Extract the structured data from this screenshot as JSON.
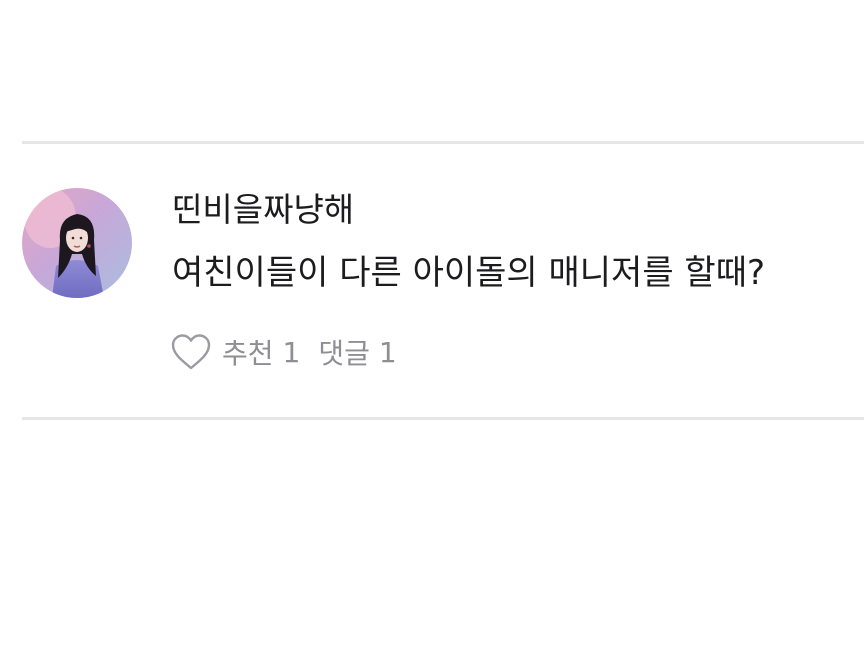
{
  "comment": {
    "author": "띤비을짜냥해",
    "text": "여친이들이 다른 아이돌의 매니저를 할때?",
    "actions": {
      "like_label": "추천",
      "like_count": "1",
      "reply_label": "댓글",
      "reply_count": "1"
    },
    "icons": {
      "like": "heart-outline-icon"
    }
  },
  "colors": {
    "text_primary": "#1c1c1e",
    "text_secondary": "#8e8e93",
    "divider": "#e6e6e8"
  }
}
